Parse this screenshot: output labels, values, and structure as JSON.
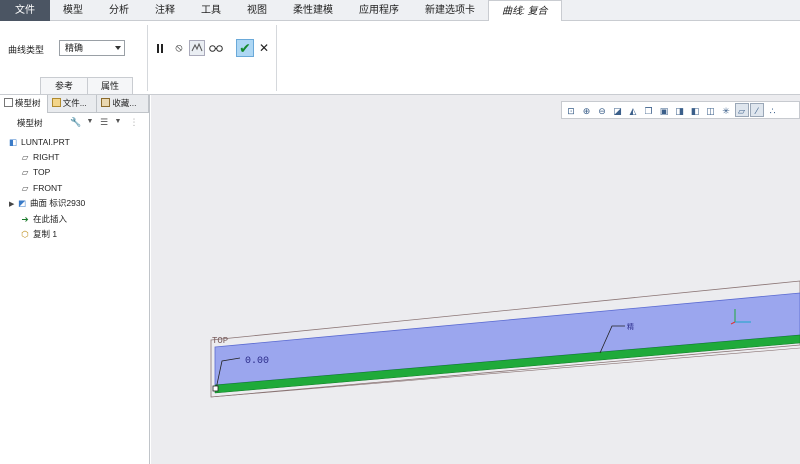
{
  "menubar": {
    "tabs": [
      {
        "label": "文件",
        "name": "tab-file"
      },
      {
        "label": "模型",
        "name": "tab-model"
      },
      {
        "label": "分析",
        "name": "tab-analysis"
      },
      {
        "label": "注释",
        "name": "tab-annotate"
      },
      {
        "label": "工具",
        "name": "tab-tools"
      },
      {
        "label": "视图",
        "name": "tab-view"
      },
      {
        "label": "柔性建模",
        "name": "tab-flexible-modeling"
      },
      {
        "label": "应用程序",
        "name": "tab-applications"
      },
      {
        "label": "新建选项卡",
        "name": "tab-new-tab"
      },
      {
        "label": "曲线: 复合",
        "name": "tab-curve-composite"
      }
    ]
  },
  "ribbon": {
    "curve_type_label": "曲线类型",
    "curve_type_value": "精确",
    "subtabs": {
      "references": "参考",
      "properties": "属性"
    }
  },
  "panel": {
    "tabs": {
      "model_tree": "模型树",
      "folder": "文件...",
      "favorites": "收藏..."
    },
    "toolbar_title": "模型树"
  },
  "tree": {
    "items": [
      {
        "label": "LUNTAI.PRT",
        "icon": "part-icon"
      },
      {
        "label": "RIGHT",
        "icon": "datum-plane-icon"
      },
      {
        "label": "TOP",
        "icon": "datum-plane-icon"
      },
      {
        "label": "FRONT",
        "icon": "datum-plane-icon"
      },
      {
        "label": "曲面 标识2930",
        "icon": "surface-icon"
      },
      {
        "label": "在此插入",
        "icon": "insert-here-arrow-icon"
      },
      {
        "label": "复制 1",
        "icon": "copy-feature-icon"
      }
    ]
  },
  "viewport": {
    "plane_label": "TOP",
    "dimension_value": "0.00",
    "curve_annotation": "精"
  },
  "colors": {
    "accent_active": "#aed7f4",
    "surface_fill": "#9ba6ee",
    "curve_green": "#1faa3a",
    "file_tab": "#4b5563"
  }
}
